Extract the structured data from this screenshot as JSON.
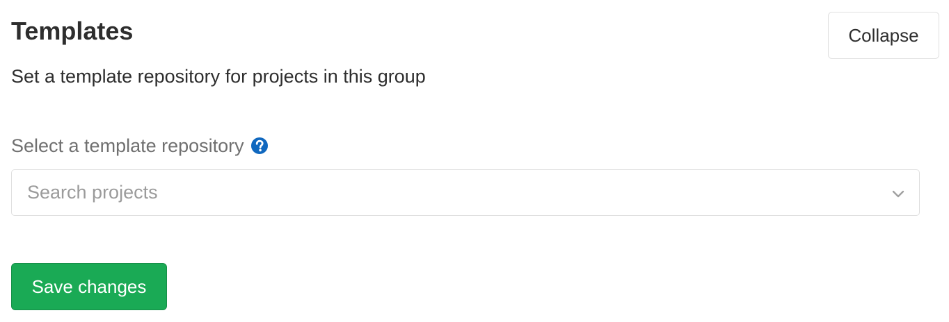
{
  "section": {
    "title": "Templates",
    "description": "Set a template repository for projects in this group",
    "collapse_label": "Collapse"
  },
  "template_field": {
    "label": "Select a template repository",
    "help_icon": "question-circle-icon",
    "placeholder": "Search projects",
    "value": "",
    "dropdown_icon": "chevron-down-icon"
  },
  "actions": {
    "save_label": "Save changes"
  },
  "colors": {
    "primary_green": "#1aaa55",
    "help_blue": "#1068bf",
    "label_gray": "#707070",
    "placeholder_gray": "#9b9b9b"
  }
}
